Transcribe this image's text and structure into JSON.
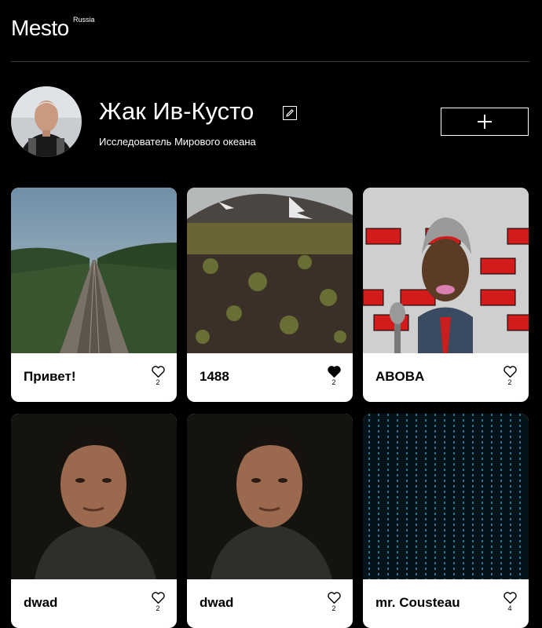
{
  "header": {
    "logo": "Mesto",
    "logo_sup": "Russia"
  },
  "profile": {
    "name": "Жак Ив-Кусто",
    "about": "Исследователь Мирового океана",
    "edit_icon": "pencil-icon",
    "add_icon": "plus-icon"
  },
  "cards": [
    {
      "title": "Привет!",
      "likes": "2",
      "liked": false,
      "image": "railway-forest"
    },
    {
      "title": "1488",
      "likes": "2",
      "liked": true,
      "image": "tundra-volcano"
    },
    {
      "title": "ABOBA",
      "likes": "2",
      "liked": false,
      "image": "cartoon-aboba"
    },
    {
      "title": "dwad",
      "likes": "2",
      "liked": false,
      "image": "man-portrait"
    },
    {
      "title": "dwad",
      "likes": "2",
      "liked": false,
      "image": "man-portrait"
    },
    {
      "title": "mr. Cousteau",
      "likes": "4",
      "liked": false,
      "image": "matrix-code"
    }
  ],
  "colors": {
    "background": "#000000",
    "card": "#ffffff",
    "text": "#ffffff",
    "card_text": "#000000"
  }
}
